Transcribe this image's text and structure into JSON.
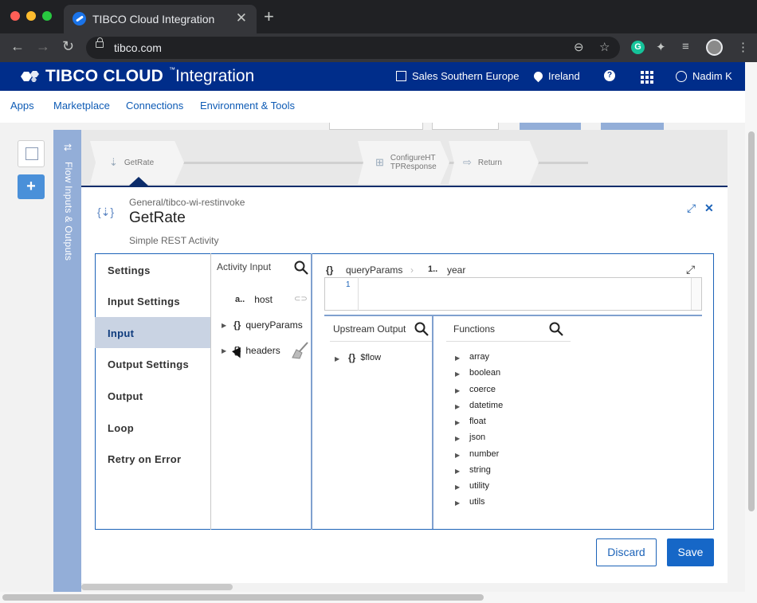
{
  "browser": {
    "tab_title": "TIBCO Cloud Integration",
    "tab_close": "✕",
    "new_tab": "+",
    "url": "tibco.com"
  },
  "app": {
    "brand": "TIBCO CLOUD",
    "brand_tm": "™",
    "brand_sub": "Integration",
    "org": "Sales Southern Europe",
    "region": "Ireland",
    "help": "?",
    "user": "Nadim K",
    "nav": [
      "Apps",
      "Marketplace",
      "Connections",
      "Environment & Tools"
    ]
  },
  "flow": {
    "strip_icon": "⇄",
    "strip_label": "Flow Inputs & Outputs",
    "steps": [
      {
        "label": "GetRate",
        "icon": "⇣"
      },
      {
        "label": "ConfigureHT TPResponse",
        "label_line1": "ConfigureHT",
        "label_line2": "TPResponse",
        "icon": "⊞"
      },
      {
        "label": "Return",
        "icon": "⇨"
      }
    ]
  },
  "activity": {
    "icon": "{⇣}",
    "path": "General/tibco-wi-restinvoke",
    "title": "GetRate",
    "description": "Simple REST Activity"
  },
  "settings_nav": {
    "items": [
      "Settings",
      "Input Settings",
      "Input",
      "Output Settings",
      "Output",
      "Loop",
      "Retry on Error"
    ],
    "active": "Input"
  },
  "activity_input": {
    "header": "Activity Input",
    "fields": [
      {
        "glyph": "a..",
        "name": "host"
      },
      {
        "glyph": "{}",
        "name": "queryParams"
      },
      {
        "glyph": "{}",
        "name": "headers"
      }
    ]
  },
  "mapper": {
    "breadcrumb_glyph": "{}",
    "breadcrumb_object": "queryParams",
    "breadcrumb_sep": "›",
    "breadcrumb_field_glyph": "1..",
    "breadcrumb_field": "year",
    "line_number": "1",
    "upstream_header": "Upstream Output",
    "upstream_items": [
      {
        "glyph": "{}",
        "name": "$flow"
      }
    ],
    "functions_header": "Functions",
    "functions": [
      "array",
      "boolean",
      "coerce",
      "datetime",
      "float",
      "json",
      "number",
      "string",
      "utility",
      "utils"
    ]
  },
  "actions": {
    "discard": "Discard",
    "save": "Save"
  },
  "icons": {
    "back": "←",
    "forward": "→",
    "reload": "↻",
    "zoom": "⊖",
    "star": "☆",
    "extension": "✦",
    "playlist": "≡",
    "menu": "⋮",
    "grammarly": "G",
    "search": "⚲",
    "expand": "⤢",
    "close": "✕",
    "link": "⊂⊃",
    "caret": "▶"
  },
  "colors": {
    "brand_blue": "#002d8a",
    "accent_blue": "#1c63b8",
    "active_nav": "#c9d3e3",
    "flow_strip": "#93aed8"
  }
}
